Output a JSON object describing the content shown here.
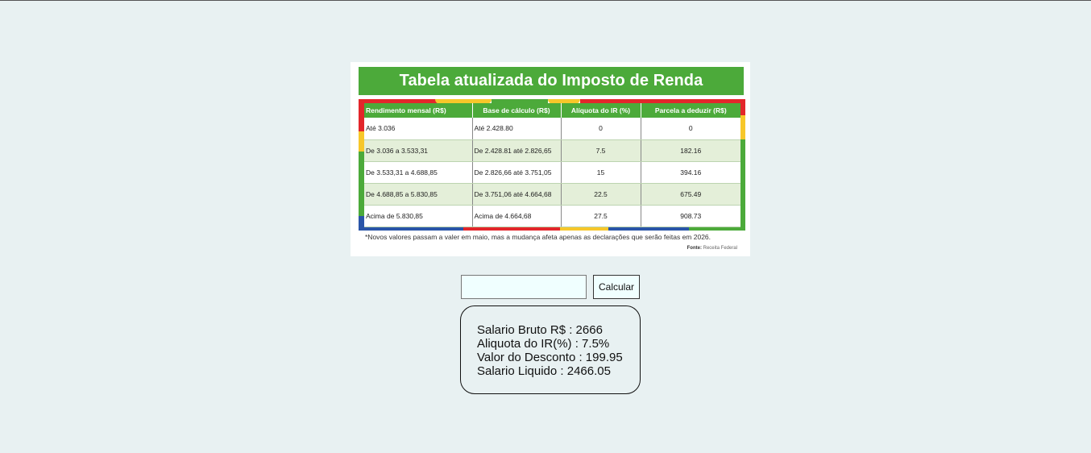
{
  "tax_table": {
    "title": "Tabela atualizada do Imposto de Renda",
    "headers": [
      "Rendimento mensal (R$)",
      "Base de cálculo (R$)",
      "Alíquota do IR (%)",
      "Parcela a deduzir (R$)"
    ],
    "rows": [
      [
        "Até 3.036",
        "Até 2.428.80",
        "0",
        "0"
      ],
      [
        "De 3.036 a 3.533,31",
        "De 2.428.81 até 2.826,65",
        "7.5",
        "182.16"
      ],
      [
        "De 3.533,31 a 4.688,85",
        "De 2.826,66 até 3.751,05",
        "15",
        "394.16"
      ],
      [
        "De 4.688,85 a 5.830,85",
        "De 3.751,06 até 4.664,68",
        "22.5",
        "675.49"
      ],
      [
        "Acima de 5.830,85",
        "Acima de 4.664,68",
        "27.5",
        "908.73"
      ]
    ],
    "note": "*Novos valores passam a valer em maio, mas a mudança afeta apenas as declarações que serão feitas em 2026.",
    "source_label": "Fonte:",
    "source_value": "Receita Federal",
    "colors": {
      "green": "#4caa3a",
      "red": "#e3262b",
      "yellow": "#f7c72a",
      "blue": "#2a55a8"
    }
  },
  "form": {
    "input_value": "",
    "input_placeholder": "",
    "button_label": "Calcular"
  },
  "result": {
    "lines": [
      "Salario Bruto R$ : 2666",
      "Aliquota do IR(%) : 7.5%",
      "Valor do Desconto : 199.95",
      "Salario Liquido : 2466.05"
    ]
  }
}
